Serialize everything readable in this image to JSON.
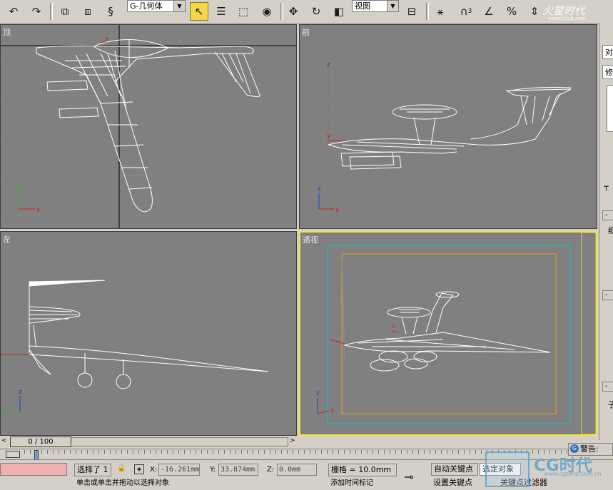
{
  "toolbar": {
    "selection_filter": "G-几何体",
    "ref_coord": "视图",
    "snap_label": "3"
  },
  "viewports": {
    "top": {
      "label": "顶"
    },
    "front": {
      "label": "前"
    },
    "left": {
      "label": "左"
    },
    "perspective": {
      "label": "透视"
    }
  },
  "axes": {
    "x": "x",
    "y": "y",
    "z": "z"
  },
  "command_panel": {
    "tab1": "对",
    "tab2": "修",
    "sub": "细",
    "sub2": "子"
  },
  "time_slider": {
    "frame_display": "0 / 100"
  },
  "status": {
    "selected": "选择了 1",
    "x_label": "X:",
    "x_value": "-16.261mm",
    "y_label": "Y:",
    "y_value": "33.874mm",
    "z_label": "Z:",
    "z_value": "0.0mm",
    "grid": "栅格 = 10.0mm",
    "auto_key": "自动关键点",
    "set_key": "设置关键点",
    "selected_obj": "选定对象",
    "key_filter": "关键点过滤器",
    "prompt": "单击或单击并拖动以选择对象",
    "add_time_tag": "添加时间标记",
    "warning": "警告:"
  },
  "watermarks": {
    "top": "火星时代",
    "top_url": "www.hxsd.com",
    "bottom": "CG时代",
    "bottom_url": "www.cgtime.com.cn"
  },
  "colors": {
    "viewport_bg": "#808080",
    "active_border": "#f5e33a",
    "wire": "#ffffff",
    "axis_x": "#d02020",
    "axis_y": "#20c020",
    "axis_z": "#2040c0"
  }
}
